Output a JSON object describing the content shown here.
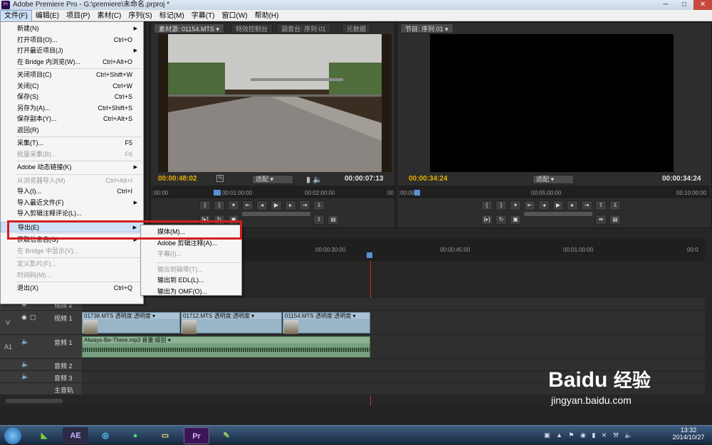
{
  "window": {
    "title": "Adobe Premiere Pro - G:\\premiere\\未命名.prproj *",
    "app_icon": "Pr",
    "minimize": "─",
    "maximize": "□",
    "close": "✕"
  },
  "menubar": [
    "文件(F)",
    "编辑(E)",
    "项目(P)",
    "素材(C)",
    "序列(S)",
    "标记(M)",
    "字幕(T)",
    "窗口(W)",
    "帮助(H)"
  ],
  "source_monitor": {
    "tabs": [
      "素材源: 01154.MTS ▾",
      "特效控制台",
      "调音台: 序列 01",
      "元数据"
    ],
    "timecode_current": "00:00:48:02",
    "timecode_duration": "00:00:07:13",
    "fit": "适配",
    "page": "½",
    "ruler": [
      ":00:00",
      "00:01:00:00",
      "00:02:00:00",
      "00"
    ]
  },
  "program_monitor": {
    "tabs": [
      "节目: 序列 01 ▾"
    ],
    "timecode_current": "00:00:34:24",
    "timecode_duration": "00:00:34:24",
    "fit": "适配",
    "ruler": [
      ":00:00",
      "00:05:00:00",
      "00:10:00:00"
    ]
  },
  "file_menu": {
    "items": [
      {
        "label": "新建(N)",
        "shortcut": "",
        "arrow": true,
        "disabled": false
      },
      {
        "label": "打开项目(O)...",
        "shortcut": "Ctrl+O",
        "disabled": false
      },
      {
        "label": "打开最近项目(J)",
        "shortcut": "",
        "arrow": true,
        "disabled": false
      },
      {
        "label": "在 Bridge 内浏览(W)...",
        "shortcut": "Ctrl+Alt+O",
        "disabled": false
      },
      {
        "sep": true
      },
      {
        "label": "关闭项目(C)",
        "shortcut": "Ctrl+Shift+W",
        "disabled": false
      },
      {
        "label": "关闭(C)",
        "shortcut": "Ctrl+W",
        "disabled": false
      },
      {
        "label": "保存(S)",
        "shortcut": "Ctrl+S",
        "disabled": false
      },
      {
        "label": "另存为(A)...",
        "shortcut": "Ctrl+Shift+S",
        "disabled": false
      },
      {
        "label": "保存副本(Y)...",
        "shortcut": "Ctrl+Alt+S",
        "disabled": false
      },
      {
        "label": "返回(R)",
        "shortcut": "",
        "disabled": false
      },
      {
        "sep": true
      },
      {
        "label": "采集(T)...",
        "shortcut": "F5",
        "disabled": false
      },
      {
        "label": "批量采集(B)...",
        "shortcut": "F6",
        "disabled": true
      },
      {
        "sep": true
      },
      {
        "label": "Adobe 动态链接(K)",
        "shortcut": "",
        "arrow": true,
        "disabled": false
      },
      {
        "sep": true
      },
      {
        "label": "从浏览器导入(M)",
        "shortcut": "Ctrl+Alt+I",
        "disabled": true
      },
      {
        "label": "导入(I)...",
        "shortcut": "Ctrl+I",
        "disabled": false
      },
      {
        "label": "导入最近文件(F)",
        "shortcut": "",
        "arrow": true,
        "disabled": false
      },
      {
        "label": "导入剪辑注释评论(L)...",
        "shortcut": "",
        "disabled": false
      },
      {
        "sep": true
      },
      {
        "label": "导出(E)",
        "shortcut": "",
        "arrow": true,
        "disabled": false,
        "highlight": true
      },
      {
        "sep": true
      },
      {
        "label": "获取信息自(G)",
        "shortcut": "",
        "arrow": true,
        "disabled": false
      },
      {
        "label": "在 Bridge 中显示(V)...",
        "shortcut": "",
        "disabled": true
      },
      {
        "sep": true
      },
      {
        "label": "定义影片(F)...",
        "shortcut": "",
        "disabled": true
      },
      {
        "label": "时间码(M)...",
        "shortcut": "",
        "disabled": true
      },
      {
        "sep": true
      },
      {
        "label": "退出(X)",
        "shortcut": "Ctrl+Q",
        "disabled": false
      }
    ]
  },
  "export_submenu": {
    "items": [
      {
        "label": "媒体(M)...",
        "disabled": false
      },
      {
        "label": "Adobe 剪辑注释(A)...",
        "disabled": false
      },
      {
        "label": "字幕(I)...",
        "disabled": true
      },
      {
        "sep": true
      },
      {
        "label": "输出到磁带(T)...",
        "disabled": true
      },
      {
        "label": "输出到 EDL(L)...",
        "disabled": false
      },
      {
        "label": "输出为 OMF(O)...",
        "disabled": false
      }
    ]
  },
  "timeline": {
    "ruler": [
      "00:00:30:00",
      "00:00:45:00",
      "00:01:00:00",
      "00:0"
    ],
    "tracks": {
      "v2": "视频 2",
      "v1": "视频 1",
      "a1": "音频 1",
      "a2": "音频 2",
      "a3": "音频 3",
      "master": "主音轨"
    },
    "v_target": "V",
    "a_target": "A1",
    "video_clips": [
      {
        "name": "01738.MTS",
        "fx": "透明度:透明度 ▾"
      },
      {
        "name": "01712.MTS",
        "fx": "透明度:透明度 ▾"
      },
      {
        "name": "01154.MTS",
        "fx": "透明度:透明度 ▾"
      }
    ],
    "audio_clip": {
      "name": "Always-Be-There.mp3",
      "fx": "音量:级别 ▾"
    }
  },
  "taskbar": {
    "apps": [
      "AE",
      "Pr"
    ],
    "time": "13:32",
    "date": "2014/10/27"
  },
  "watermark": {
    "brand": "Baidu",
    "brand_cn": "经验",
    "url": "jingyan.baidu.com"
  }
}
